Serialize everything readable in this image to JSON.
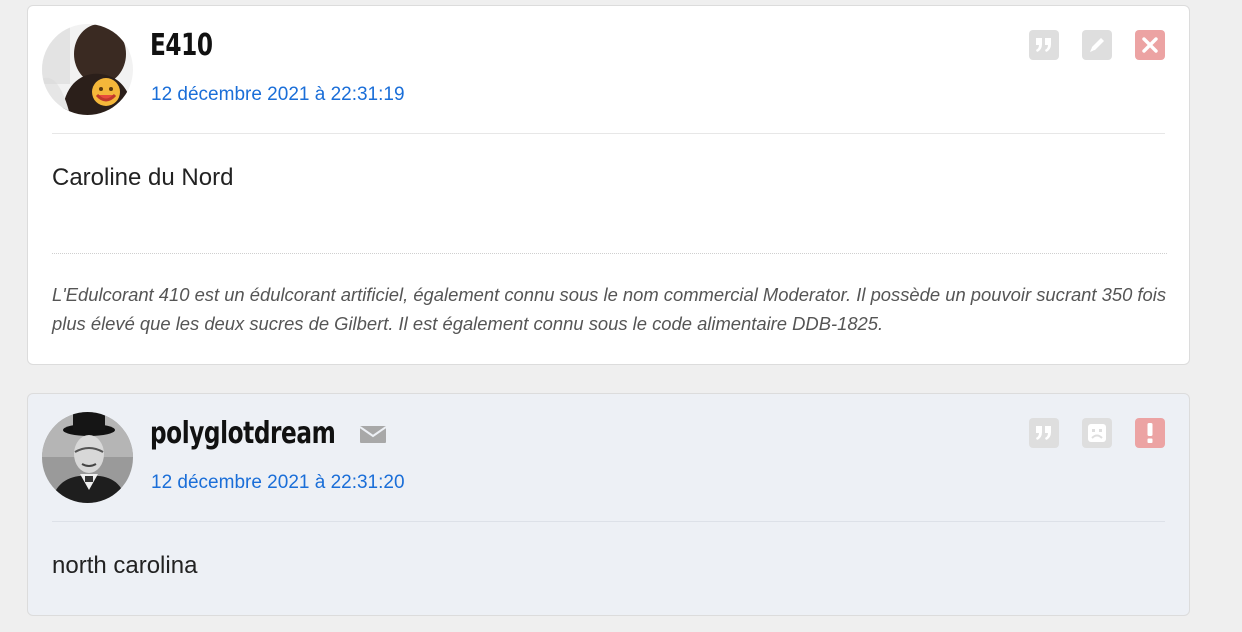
{
  "posts": [
    {
      "username": "E410",
      "date": "12 décembre 2021 à 22:31:19",
      "message": "Caroline du Nord",
      "signature": "L'Edulcorant 410 est un édulcorant artificiel, également connu sous le nom commercial Moderator. Il possède un pouvoir sucrant 350 fois plus élevé que les deux sucres de Gilbert. Il est également connu sous le code alimentaire DDB-1825.",
      "actions": [
        "quote-icon",
        "edit-icon",
        "delete-icon"
      ]
    },
    {
      "username": "polyglotdream",
      "date": "12 décembre 2021 à 22:31:20",
      "message": "north carolina",
      "actions": [
        "quote-icon",
        "sad-face-icon",
        "report-icon"
      ],
      "has_mail_icon": true
    }
  ],
  "colors": {
    "link": "#1a6ed8",
    "action_grey": "#dedede",
    "action_red": "#eca3a3",
    "post2_bg": "#edf0f5"
  }
}
